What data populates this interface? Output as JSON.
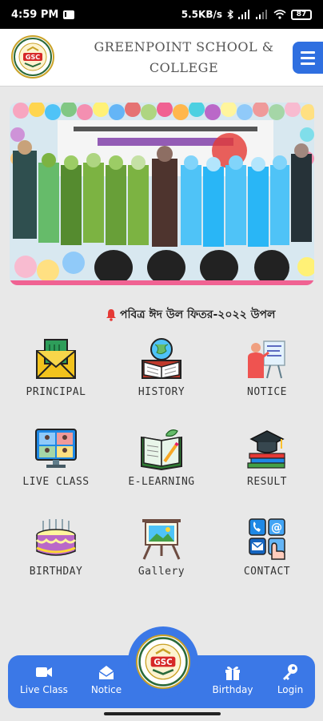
{
  "status": {
    "time": "4:59 PM",
    "net_speed": "5.5KB/s",
    "battery": "87"
  },
  "header": {
    "title_line1": "GREENPOINT SCHOOL &",
    "title_line2": "COLLEGE",
    "logo_icon": "school-logo",
    "menu_icon": "hamburger-menu-icon"
  },
  "banner": {
    "image": "school-event-photo"
  },
  "ticker": {
    "text": "পবিত্র ঈদ উল ফিতর-২০২২ উপল",
    "icon": "bell-icon",
    "icon_color": "#e53935"
  },
  "grid": [
    {
      "label": "PRINCIPAL",
      "icon": "envelope-icon"
    },
    {
      "label": "HISTORY",
      "icon": "book-globe-icon"
    },
    {
      "label": "NOTICE",
      "icon": "presentation-board-icon"
    },
    {
      "label": "LIVE CLASS",
      "icon": "video-conference-icon"
    },
    {
      "label": "E-LEARNING",
      "icon": "open-book-pencil-icon"
    },
    {
      "label": "RESULT",
      "icon": "graduation-cap-books-icon"
    },
    {
      "label": "BIRTHDAY",
      "icon": "birthday-cake-icon"
    },
    {
      "label": "Gallery",
      "icon": "easel-picture-icon"
    },
    {
      "label": "CONTACT",
      "icon": "contact-grid-icon"
    }
  ],
  "bottom_nav": {
    "items": [
      {
        "label": "Live Class",
        "icon": "video-camera-icon"
      },
      {
        "label": "Notice",
        "icon": "inbox-icon"
      },
      {
        "label": "Birthday",
        "icon": "gift-icon"
      },
      {
        "label": "Login",
        "icon": "key-icon"
      }
    ],
    "center_icon": "school-logo",
    "accent": "#3b78e7"
  }
}
